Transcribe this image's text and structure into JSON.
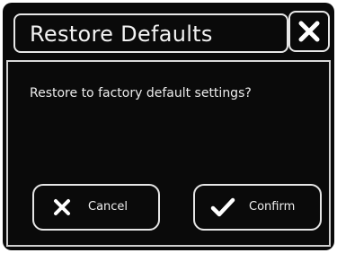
{
  "dialog": {
    "title": "Restore Defaults",
    "close_icon": "close-icon",
    "message": "Restore to factory default settings?",
    "buttons": {
      "cancel": {
        "label": "Cancel",
        "icon": "x-icon"
      },
      "confirm": {
        "label": "Confirm",
        "icon": "checkmark-icon"
      }
    }
  },
  "colors": {
    "background": "#0a0a0a",
    "text": "#ededed",
    "border": "#e8e8e8"
  }
}
